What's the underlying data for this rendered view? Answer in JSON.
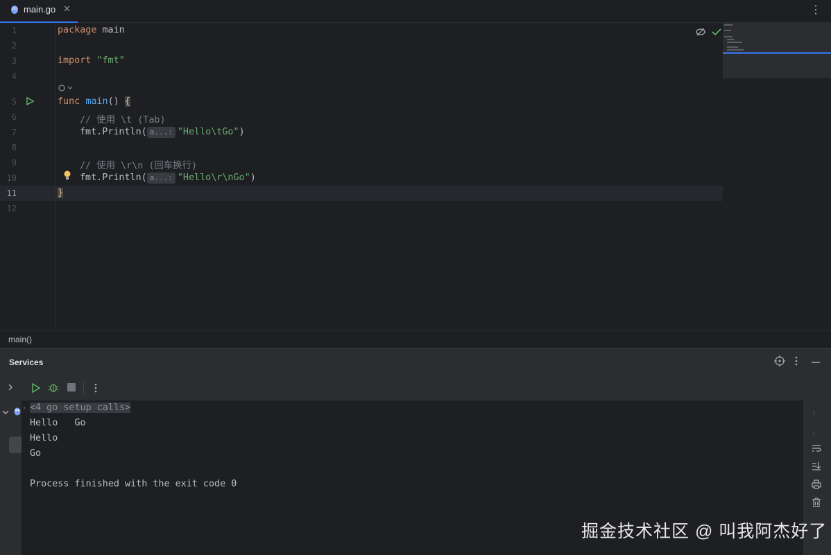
{
  "tab": {
    "filename": "main.go",
    "close": "✕",
    "more": "⋮"
  },
  "editor": {
    "line_numbers": [
      "1",
      "2",
      "3",
      "4",
      "5",
      "6",
      "7",
      "8",
      "9",
      "10",
      "11",
      "12"
    ],
    "current_line": "11",
    "lines": {
      "l1_kw": "package",
      "l1_rest": " main",
      "l3_kw": "import",
      "l3_str": "\"fmt\"",
      "l5_kw": "func",
      "l5_fn": "main",
      "l5_rest": "() ",
      "l5_brace": "{",
      "l6_comment": "// 使用 \\t (Tab)",
      "l7_pre": "fmt.Println(",
      "l7_hint": "a...:",
      "l7_str": "\"Hello\\tGo\"",
      "l7_post": ")",
      "l9_comment": "// 使用 \\r\\n (回车换行)",
      "l10_pre": "fmt.Println(",
      "l10_hint": "a...:",
      "l10_str": "\"Hello\\r\\nGo\"",
      "l10_post": ")",
      "l11_brace": "}"
    }
  },
  "breadcrumb": "main()",
  "services": {
    "title": "Services",
    "console": {
      "setup": "<4 go setup calls>",
      "lines": [
        "Hello   Go",
        "Hello",
        "Go",
        "",
        "Process finished with the exit code 0"
      ]
    }
  },
  "watermark": "掘金技术社区 @ 叫我阿杰好了",
  "colors": {
    "accent": "#3574f0",
    "keyword": "#cf8e6d",
    "string": "#6aab73",
    "function": "#56a8f5",
    "run_green": "#5fb865"
  }
}
